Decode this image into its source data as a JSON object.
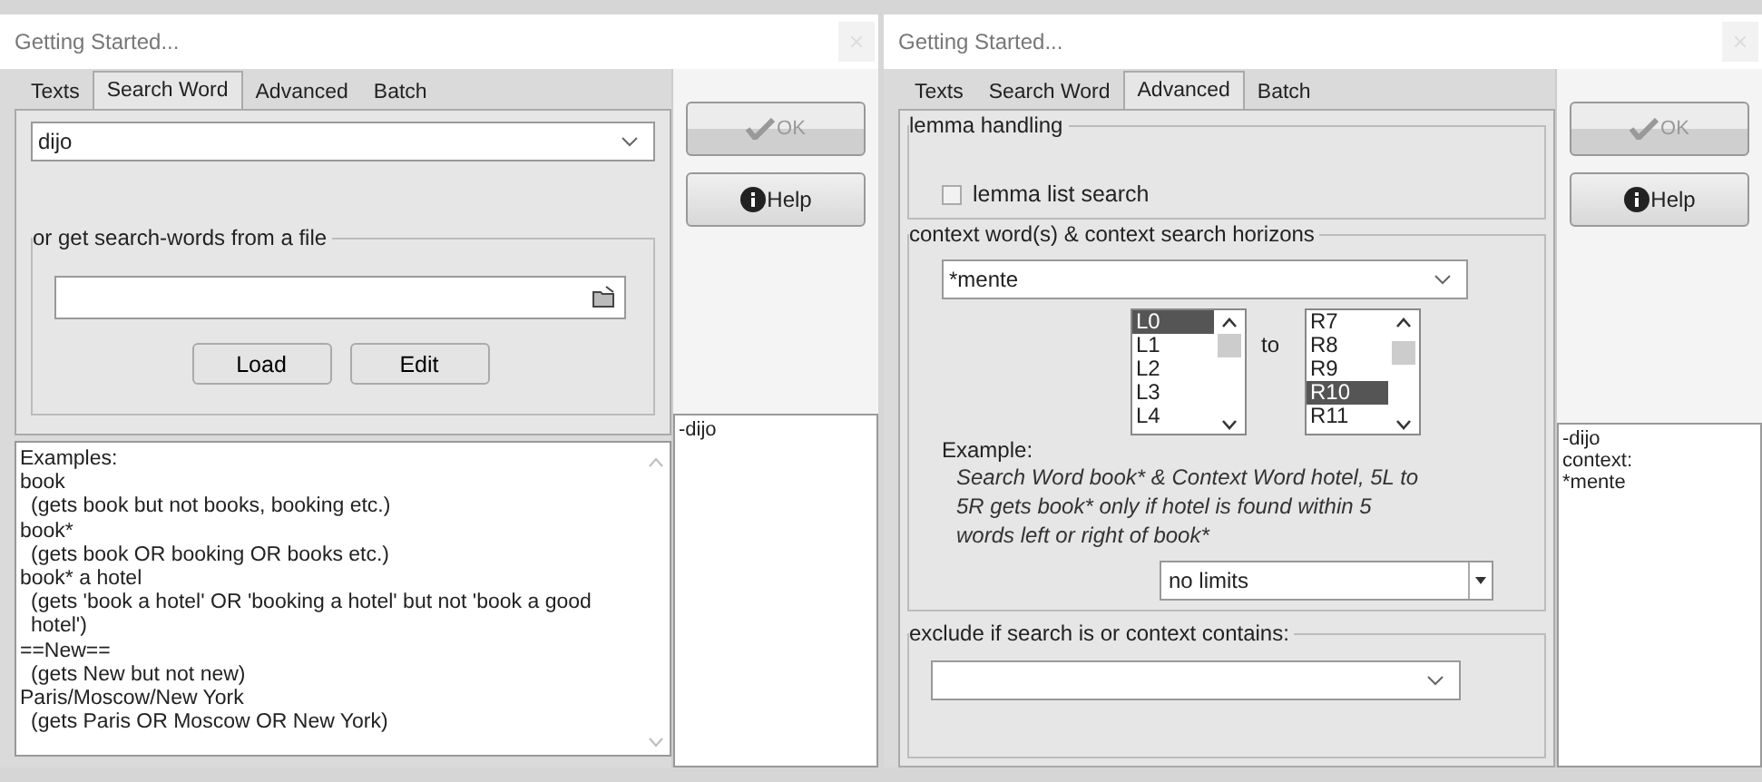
{
  "screens": [
    {
      "kind": "search_word",
      "title": "Getting Started...",
      "tabs": [
        {
          "label": "Texts",
          "selected": false
        },
        {
          "label": "Search Word",
          "selected": true
        },
        {
          "label": "Advanced",
          "selected": false
        },
        {
          "label": "Batch",
          "selected": false
        }
      ],
      "search_word": {
        "value": "dijo"
      },
      "file_group": {
        "legend": "or get search-words from a file",
        "buttons": [
          "Load",
          "Edit"
        ]
      },
      "examples": {
        "heading": "Examples:",
        "items": [
          {
            "pattern": "book",
            "note": "(gets book but not books, booking etc.)"
          },
          {
            "pattern": "book*",
            "note": "(gets book OR booking OR books etc.)"
          },
          {
            "pattern": "book* a hotel",
            "note": "(gets 'book a hotel' OR 'booking a hotel' but not 'book a good hotel')"
          },
          {
            "pattern": "==New==",
            "note": "(gets New but not new)"
          },
          {
            "pattern": "Paris/Moscow/New York",
            "note": "(gets Paris OR Moscow OR New York)"
          }
        ]
      },
      "buttons": [
        {
          "label": "OK",
          "kind": "ok",
          "disabled": true
        },
        {
          "label": "Help",
          "kind": "help",
          "disabled": false
        }
      ],
      "output": [
        "-dijo"
      ]
    },
    {
      "kind": "advanced",
      "title": "Getting Started...",
      "tabs": [
        {
          "label": "Texts",
          "selected": false
        },
        {
          "label": "Search Word",
          "selected": false
        },
        {
          "label": "Advanced",
          "selected": true
        },
        {
          "label": "Batch",
          "selected": false
        }
      ],
      "lemma": {
        "legend": "lemma handling",
        "checkbox": {
          "label": "lemma list search",
          "checked": false
        }
      },
      "context": {
        "legend": "context word(s) & context search horizons",
        "value": "*mente",
        "from_list": [
          {
            "label": "L0",
            "selected": true
          },
          {
            "label": "L1",
            "selected": false
          },
          {
            "label": "L2",
            "selected": false
          },
          {
            "label": "L3",
            "selected": false
          },
          {
            "label": "L4",
            "selected": false
          }
        ],
        "to_label": "to",
        "to_list": [
          {
            "label": "R7",
            "selected": false
          },
          {
            "label": "R8",
            "selected": false
          },
          {
            "label": "R9",
            "selected": false
          },
          {
            "label": "R10",
            "selected": true
          },
          {
            "label": "R11",
            "selected": false
          }
        ],
        "example_label": "Example:",
        "example_text": "Search Word book* & Context Word hotel, 5L to 5R gets book* only if hotel is found within 5 words left or right of book*",
        "limit": "no limits"
      },
      "exclude": {
        "legend": "exclude if search is or context contains:"
      },
      "buttons": [
        {
          "label": "OK",
          "kind": "ok",
          "disabled": true
        },
        {
          "label": "Help",
          "kind": "help",
          "disabled": false
        }
      ],
      "output": [
        "-dijo",
        "context:",
        "*mente"
      ]
    }
  ]
}
